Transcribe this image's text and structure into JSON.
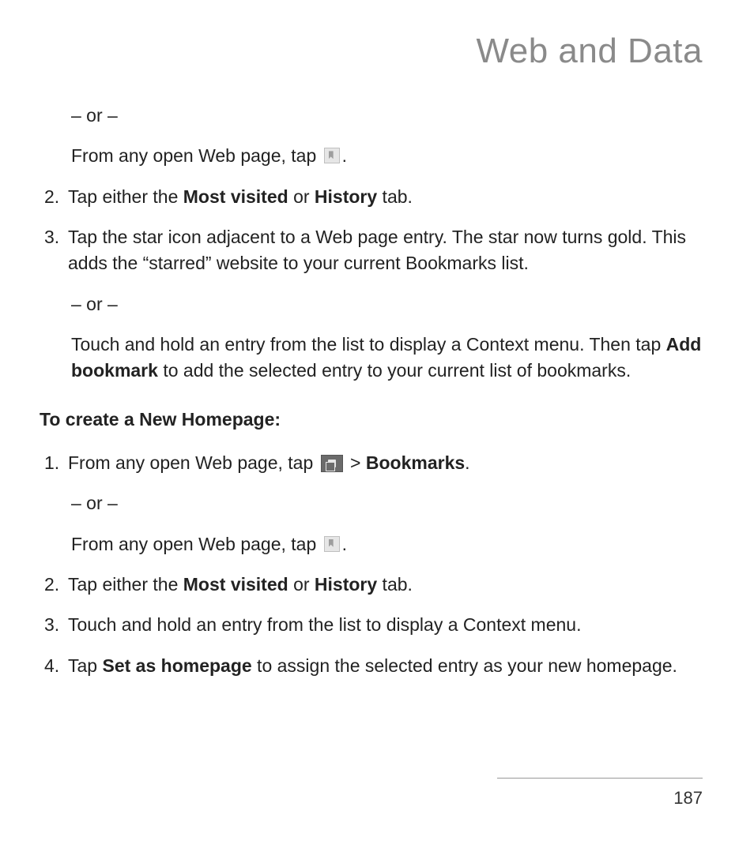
{
  "title": "Web and Data",
  "or_text": "– or –",
  "sectionA": {
    "from_any_1_pre": "From any open Web page, tap ",
    "from_any_1_post": ".",
    "step2_pre": "Tap either the ",
    "step2_mv": "Most visited",
    "step2_mid": " or ",
    "step2_hist": "History",
    "step2_post": " tab.",
    "step3": "Tap the star icon adjacent to a Web page entry. The star now turns gold. This adds the “starred” website to your current Bookmarks list.",
    "touch_hold_pre": "Touch and hold an entry from the list to display a Context menu. Then tap ",
    "touch_hold_bold": "Add bookmark",
    "touch_hold_post": " to add the selected entry to your current list of bookmarks."
  },
  "heading": "To create a New Homepage:",
  "sectionB": {
    "step1_pre": "From any open Web page, tap ",
    "step1_mid": "  > ",
    "step1_bold": "Bookmarks",
    "step1_post": ".",
    "from_any_2_pre": "From any open Web page, tap ",
    "from_any_2_post": ".",
    "step2_pre": "Tap either the ",
    "step2_mv": "Most visited",
    "step2_mid": " or ",
    "step2_hist": "History",
    "step2_post": " tab.",
    "step3": "Touch and hold an entry from the list to display a Context menu.",
    "step4_pre": "Tap ",
    "step4_bold": "Set as homepage",
    "step4_post": " to assign the selected entry as your new homepage."
  },
  "numbers": {
    "n1": "1.",
    "n2": "2.",
    "n3": "3.",
    "n4": "4."
  },
  "page_number": "187"
}
